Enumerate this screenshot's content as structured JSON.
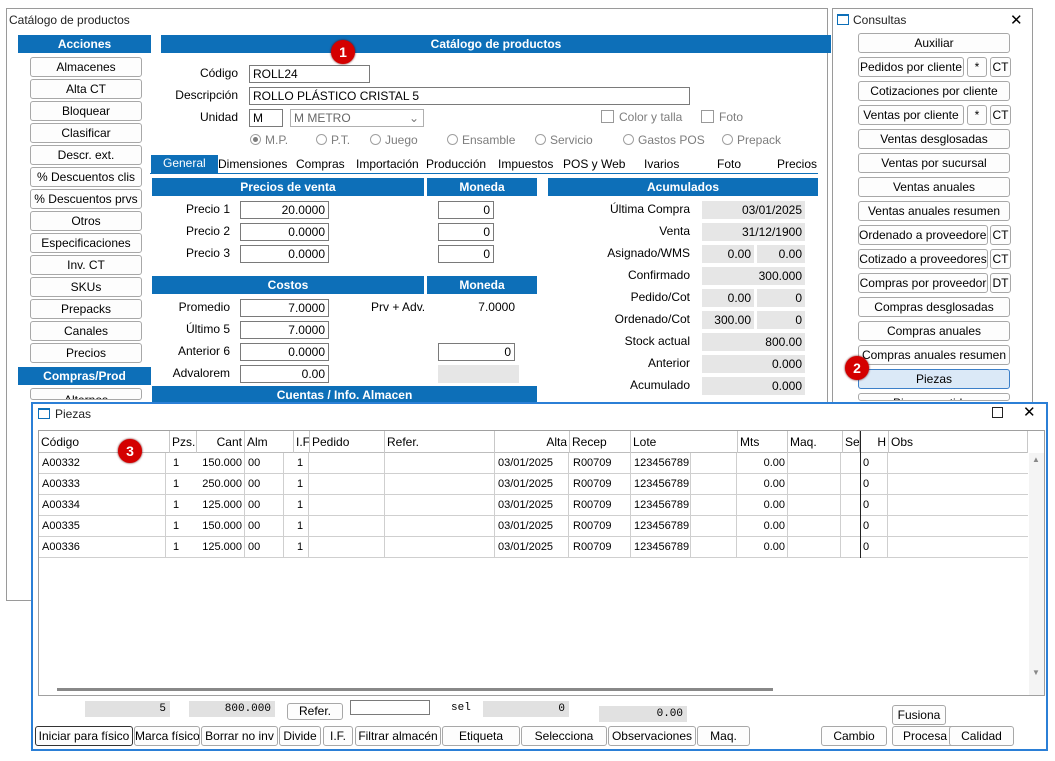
{
  "catalog_window": {
    "title": "Catálogo de productos",
    "header": "Catálogo de productos",
    "acciones_header": "Acciones",
    "acciones": [
      "Almacenes",
      "Alta CT",
      "Bloquear",
      "Clasificar",
      "Descr. ext.",
      "% Descuentos clis",
      "% Descuentos prvs",
      "Otros",
      "Especificaciones",
      "Inv. CT",
      "SKUs",
      "Prepacks",
      "Canales",
      "Precios"
    ],
    "compras_header": "Compras/Prod",
    "compras_first": "Alternos",
    "codigo_label": "Código",
    "codigo_value": "ROLL24",
    "descripcion_label": "Descripción",
    "descripcion_value": "ROLLO PLÁSTICO CRISTAL 5",
    "unidad_label": "Unidad",
    "unidad_value": "M",
    "unidad_select": "M  METRO",
    "color_talla": "Color y talla",
    "foto_chk": "Foto",
    "radios": [
      "M.P.",
      "P.T.",
      "Juego",
      "Ensamble",
      "Servicio",
      "Gastos POS",
      "Prepack"
    ],
    "tabs": [
      "General",
      "Dimensiones",
      "Compras",
      "Importación",
      "Producción",
      "Impuestos",
      "POS y Web",
      "Ivarios",
      "Foto",
      "Precios"
    ],
    "precios_header": "Precios de venta",
    "moneda_header": "Moneda",
    "precios": [
      {
        "label": "Precio 1",
        "value": "20.0000",
        "moneda": "0"
      },
      {
        "label": "Precio 2",
        "value": "0.0000",
        "moneda": "0"
      },
      {
        "label": "Precio 3",
        "value": "0.0000",
        "moneda": "0"
      }
    ],
    "costos_header": "Costos",
    "costos": [
      {
        "label": "Promedio",
        "value": "7.0000"
      },
      {
        "label": "Último 5",
        "value": "7.0000"
      },
      {
        "label": "Anterior 6",
        "value": "0.0000"
      },
      {
        "label": "Advalorem",
        "value": "0.00"
      }
    ],
    "prv_adv_label": "Prv + Adv.",
    "prv_adv_value": "7.0000",
    "costos_moneda": "0",
    "cuentas_header": "Cuentas / Info. Almacen",
    "acumulados_header": "Acumulados",
    "acumulados": [
      {
        "label": "Última  Compra",
        "v1": "03/01/2025"
      },
      {
        "label": "Venta",
        "v1": "31/12/1900"
      },
      {
        "label": "Asignado/WMS",
        "v1": "0.00",
        "v2": "0.00"
      },
      {
        "label": "Confirmado",
        "v1": "300.000"
      },
      {
        "label": "Pedido/Cot",
        "v1": "0.00",
        "v2": "0"
      },
      {
        "label": "Ordenado/Cot",
        "v1": "300.00",
        "v2": "0"
      },
      {
        "label": "Stock actual",
        "v1": "800.00"
      },
      {
        "label": "Anterior",
        "v1": "0.000"
      },
      {
        "label": "Acumulado",
        "v1": "0.000"
      }
    ]
  },
  "consultas": {
    "title": "Consultas",
    "items": [
      {
        "label": "Auxiliar"
      },
      {
        "label": "Pedidos por cliente",
        "extra": [
          "*",
          "CT"
        ]
      },
      {
        "label": "Cotizaciones por cliente"
      },
      {
        "label": "Ventas por cliente",
        "extra": [
          "*",
          "CT"
        ]
      },
      {
        "label": "Ventas desglosadas"
      },
      {
        "label": "Ventas por sucursal"
      },
      {
        "label": "Ventas anuales"
      },
      {
        "label": "Ventas anuales resumen"
      },
      {
        "label": "Ordenado a proveedores",
        "extra": [
          "CT"
        ]
      },
      {
        "label": "Cotizado a proveedores",
        "extra": [
          "CT"
        ]
      },
      {
        "label": "Compras por proveedor",
        "extra": [
          "DT"
        ]
      },
      {
        "label": "Compras desglosadas"
      },
      {
        "label": "Compras anuales"
      },
      {
        "label": "Compras anuales resumen"
      },
      {
        "label": "Piezas"
      },
      {
        "label": "Piezas partidas"
      }
    ]
  },
  "piezas": {
    "title": "Piezas",
    "columns": [
      "Código",
      "Pzs.",
      "Cant",
      "Alm",
      "I.F.",
      "Pedido",
      "Refer.",
      "Alta",
      "Recep",
      "Lote",
      "Mts",
      "Maq.",
      "Se",
      "H",
      "Obs"
    ],
    "rows": [
      [
        "A00332",
        "1",
        "150.000",
        "00",
        "1",
        "",
        "",
        "03/01/2025",
        "R00709",
        "123456789",
        "0.00",
        "",
        "",
        "0",
        ""
      ],
      [
        "A00333",
        "1",
        "250.000",
        "00",
        "1",
        "",
        "",
        "03/01/2025",
        "R00709",
        "123456789",
        "0.00",
        "",
        "",
        "0",
        ""
      ],
      [
        "A00334",
        "1",
        "125.000",
        "00",
        "1",
        "",
        "",
        "03/01/2025",
        "R00709",
        "123456789",
        "0.00",
        "",
        "",
        "0",
        ""
      ],
      [
        "A00335",
        "1",
        "150.000",
        "00",
        "1",
        "",
        "",
        "03/01/2025",
        "R00709",
        "123456789",
        "0.00",
        "",
        "",
        "0",
        ""
      ],
      [
        "A00336",
        "1",
        "125.000",
        "00",
        "1",
        "",
        "",
        "03/01/2025",
        "R00709",
        "123456789",
        "0.00",
        "",
        "",
        "0",
        ""
      ]
    ],
    "count": "5",
    "total": "800.000",
    "refer_btn": "Refer.",
    "sel_label": "sel",
    "sel_value": "0",
    "sel_total": "0.00",
    "fusiona": "Fusiona",
    "bottom_buttons": [
      "Iniciar para físico",
      "Marca físico",
      "Borrar no inv",
      "Divide",
      "I.F.",
      "Filtrar almacén",
      "Etiqueta",
      "Selecciona",
      "Observaciones",
      "Maq."
    ],
    "right_buttons": [
      "Cambio",
      "Procesa",
      "Calidad"
    ]
  },
  "badges": [
    "1",
    "2",
    "3"
  ],
  "colors": {
    "accent": "#0d6fb8",
    "badge": "#d40000",
    "selected_btn": "#dbe9f7"
  }
}
